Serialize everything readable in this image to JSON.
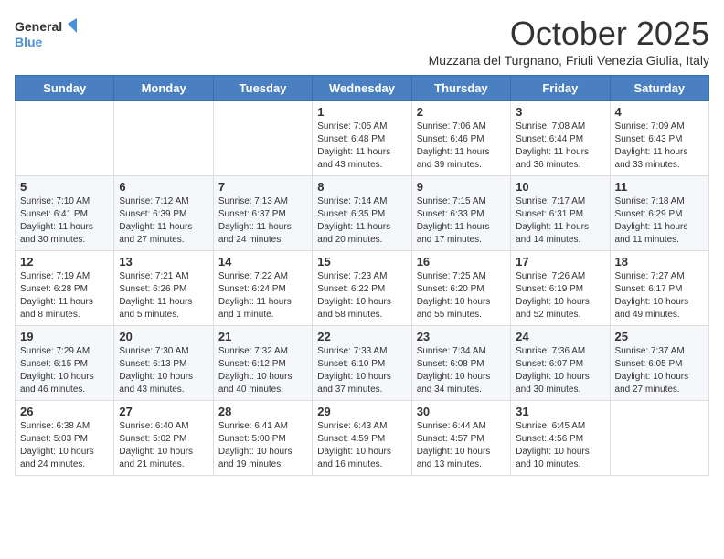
{
  "header": {
    "logo_line1": "General",
    "logo_line2": "Blue",
    "title": "October 2025",
    "subtitle": "Muzzana del Turgnano, Friuli Venezia Giulia, Italy"
  },
  "weekdays": [
    "Sunday",
    "Monday",
    "Tuesday",
    "Wednesday",
    "Thursday",
    "Friday",
    "Saturday"
  ],
  "weeks": [
    [
      {
        "day": "",
        "info": ""
      },
      {
        "day": "",
        "info": ""
      },
      {
        "day": "",
        "info": ""
      },
      {
        "day": "1",
        "info": "Sunrise: 7:05 AM\nSunset: 6:48 PM\nDaylight: 11 hours and 43 minutes."
      },
      {
        "day": "2",
        "info": "Sunrise: 7:06 AM\nSunset: 6:46 PM\nDaylight: 11 hours and 39 minutes."
      },
      {
        "day": "3",
        "info": "Sunrise: 7:08 AM\nSunset: 6:44 PM\nDaylight: 11 hours and 36 minutes."
      },
      {
        "day": "4",
        "info": "Sunrise: 7:09 AM\nSunset: 6:43 PM\nDaylight: 11 hours and 33 minutes."
      }
    ],
    [
      {
        "day": "5",
        "info": "Sunrise: 7:10 AM\nSunset: 6:41 PM\nDaylight: 11 hours and 30 minutes."
      },
      {
        "day": "6",
        "info": "Sunrise: 7:12 AM\nSunset: 6:39 PM\nDaylight: 11 hours and 27 minutes."
      },
      {
        "day": "7",
        "info": "Sunrise: 7:13 AM\nSunset: 6:37 PM\nDaylight: 11 hours and 24 minutes."
      },
      {
        "day": "8",
        "info": "Sunrise: 7:14 AM\nSunset: 6:35 PM\nDaylight: 11 hours and 20 minutes."
      },
      {
        "day": "9",
        "info": "Sunrise: 7:15 AM\nSunset: 6:33 PM\nDaylight: 11 hours and 17 minutes."
      },
      {
        "day": "10",
        "info": "Sunrise: 7:17 AM\nSunset: 6:31 PM\nDaylight: 11 hours and 14 minutes."
      },
      {
        "day": "11",
        "info": "Sunrise: 7:18 AM\nSunset: 6:29 PM\nDaylight: 11 hours and 11 minutes."
      }
    ],
    [
      {
        "day": "12",
        "info": "Sunrise: 7:19 AM\nSunset: 6:28 PM\nDaylight: 11 hours and 8 minutes."
      },
      {
        "day": "13",
        "info": "Sunrise: 7:21 AM\nSunset: 6:26 PM\nDaylight: 11 hours and 5 minutes."
      },
      {
        "day": "14",
        "info": "Sunrise: 7:22 AM\nSunset: 6:24 PM\nDaylight: 11 hours and 1 minute."
      },
      {
        "day": "15",
        "info": "Sunrise: 7:23 AM\nSunset: 6:22 PM\nDaylight: 10 hours and 58 minutes."
      },
      {
        "day": "16",
        "info": "Sunrise: 7:25 AM\nSunset: 6:20 PM\nDaylight: 10 hours and 55 minutes."
      },
      {
        "day": "17",
        "info": "Sunrise: 7:26 AM\nSunset: 6:19 PM\nDaylight: 10 hours and 52 minutes."
      },
      {
        "day": "18",
        "info": "Sunrise: 7:27 AM\nSunset: 6:17 PM\nDaylight: 10 hours and 49 minutes."
      }
    ],
    [
      {
        "day": "19",
        "info": "Sunrise: 7:29 AM\nSunset: 6:15 PM\nDaylight: 10 hours and 46 minutes."
      },
      {
        "day": "20",
        "info": "Sunrise: 7:30 AM\nSunset: 6:13 PM\nDaylight: 10 hours and 43 minutes."
      },
      {
        "day": "21",
        "info": "Sunrise: 7:32 AM\nSunset: 6:12 PM\nDaylight: 10 hours and 40 minutes."
      },
      {
        "day": "22",
        "info": "Sunrise: 7:33 AM\nSunset: 6:10 PM\nDaylight: 10 hours and 37 minutes."
      },
      {
        "day": "23",
        "info": "Sunrise: 7:34 AM\nSunset: 6:08 PM\nDaylight: 10 hours and 34 minutes."
      },
      {
        "day": "24",
        "info": "Sunrise: 7:36 AM\nSunset: 6:07 PM\nDaylight: 10 hours and 30 minutes."
      },
      {
        "day": "25",
        "info": "Sunrise: 7:37 AM\nSunset: 6:05 PM\nDaylight: 10 hours and 27 minutes."
      }
    ],
    [
      {
        "day": "26",
        "info": "Sunrise: 6:38 AM\nSunset: 5:03 PM\nDaylight: 10 hours and 24 minutes."
      },
      {
        "day": "27",
        "info": "Sunrise: 6:40 AM\nSunset: 5:02 PM\nDaylight: 10 hours and 21 minutes."
      },
      {
        "day": "28",
        "info": "Sunrise: 6:41 AM\nSunset: 5:00 PM\nDaylight: 10 hours and 19 minutes."
      },
      {
        "day": "29",
        "info": "Sunrise: 6:43 AM\nSunset: 4:59 PM\nDaylight: 10 hours and 16 minutes."
      },
      {
        "day": "30",
        "info": "Sunrise: 6:44 AM\nSunset: 4:57 PM\nDaylight: 10 hours and 13 minutes."
      },
      {
        "day": "31",
        "info": "Sunrise: 6:45 AM\nSunset: 4:56 PM\nDaylight: 10 hours and 10 minutes."
      },
      {
        "day": "",
        "info": ""
      }
    ]
  ]
}
